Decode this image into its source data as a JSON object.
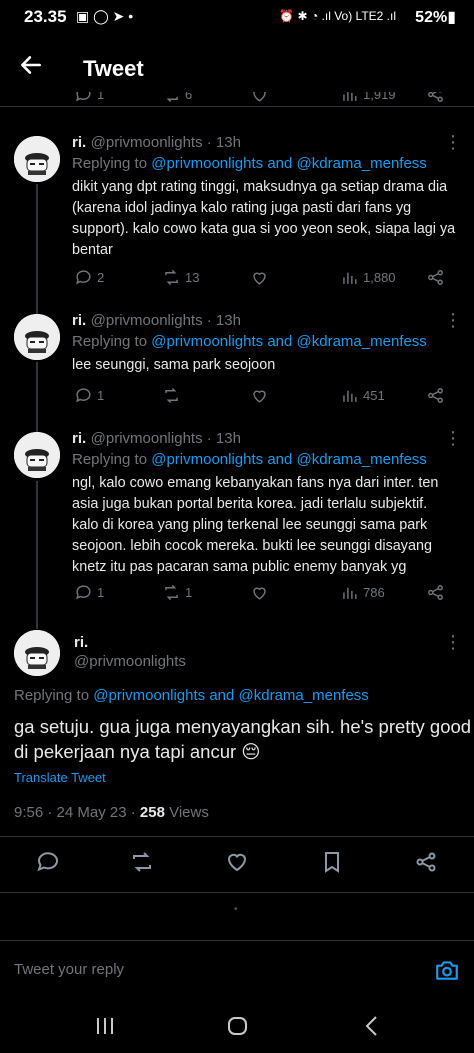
{
  "status_bar": {
    "time": "23.35",
    "left_icons": "▣ ◯ ➤ •",
    "right_icons": "⏰ ✱ ◔ .ıl Vo) LTE2 .ıl",
    "battery": "52%▮"
  },
  "header": {
    "title": "Tweet",
    "back_icon": "arrow-left-icon"
  },
  "prev_stats": {
    "retweets": "6",
    "views": "1,919"
  },
  "tweets": [
    {
      "name": "ri.",
      "handle": "@privmoonlights · 13h",
      "replying_prefix": "Replying to ",
      "replying_users": "@privmoonlights and @kdrama_menfess",
      "lines": [
        "dikit yang dpt rating tinggi, maksudnya ga setiap drama dia",
        "(karena idol jadinya kalo rating juga pasti dari fans yg",
        "support). kalo cowo kata gua si yoo yeon seok, siapa lagi ya",
        "bentar"
      ],
      "replies": "2",
      "retweets": "13",
      "likes": "",
      "views": "1,880"
    },
    {
      "name": "ri.",
      "handle": "@privmoonlights · 13h",
      "replying_prefix": "Replying to ",
      "replying_users": "@privmoonlights and @kdrama_menfess",
      "lines": [
        "lee seunggi, sama park seojoon"
      ],
      "replies": "1",
      "retweets": "",
      "likes": "",
      "views": "451"
    },
    {
      "name": "ri.",
      "handle": "@privmoonlights · 13h",
      "replying_prefix": "Replying to ",
      "replying_users": "@privmoonlights and @kdrama_menfess",
      "lines": [
        "ngl, kalo cowo emang kebanyakan fans nya dari inter. ten",
        "asia juga bukan portal berita korea. jadi terlalu subjektif.",
        "kalo di korea yang pling terkenal lee seunggi sama park",
        "seojoon. lebih cocok mereka. bukti lee seunggi disayang",
        "knetz itu pas pacaran sama public enemy banyak yg"
      ],
      "replies": "1",
      "retweets": "1",
      "likes": "",
      "views": "786"
    }
  ],
  "main_tweet": {
    "name": "ri.",
    "handle": "@privmoonlights",
    "replying_prefix": "Replying to ",
    "replying_users": "@privmoonlights and @kdrama_menfess",
    "line1": "ga setuju. gua juga menyayangkan sih. he's pretty good",
    "line2": "di pekerjaan nya tapi ancur 😔",
    "translate": "Translate Tweet",
    "time": "9:56 · 24 May 23 · ",
    "views_count": "258",
    "views_label": " Views"
  },
  "reply_bar": {
    "placeholder": "Tweet your reply"
  },
  "loading_dot": "•"
}
